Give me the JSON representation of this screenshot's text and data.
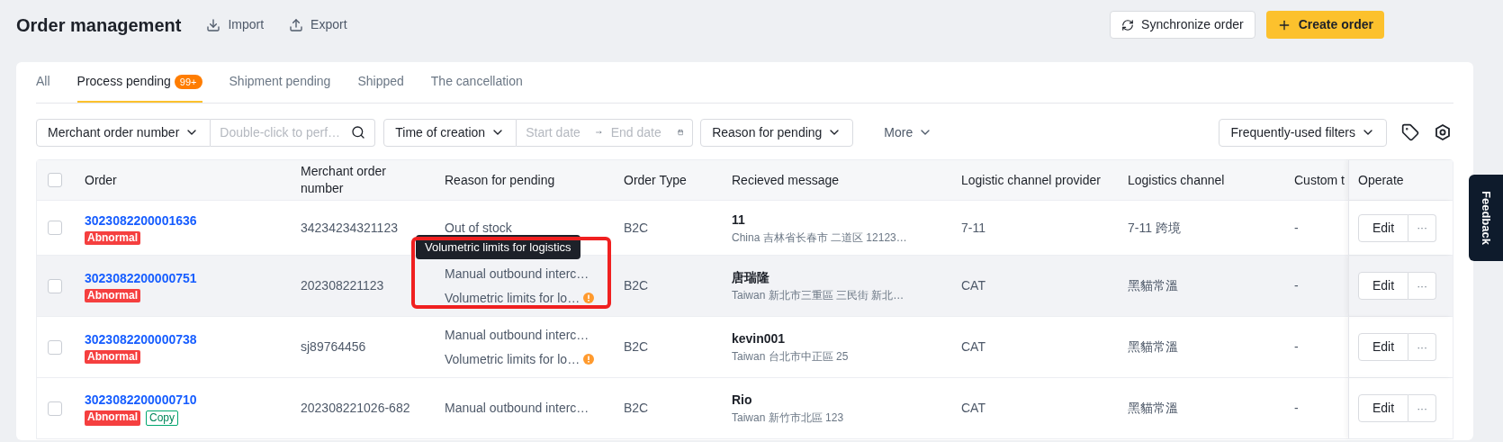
{
  "header": {
    "title": "Order management",
    "actions": [
      {
        "label": "Import",
        "kind": "import"
      },
      {
        "label": "Export",
        "kind": "export"
      }
    ],
    "buttons": [
      {
        "label": "Synchronize order",
        "kind": "secondary"
      },
      {
        "label": "Create order",
        "kind": "primary"
      }
    ]
  },
  "tabs": [
    {
      "label": "All",
      "selected": false
    },
    {
      "label": "Process pending",
      "badge": "99+",
      "selected": true
    },
    {
      "label": "Shipment pending",
      "selected": false
    },
    {
      "label": "Shipped",
      "selected": false
    },
    {
      "label": "The cancellation",
      "selected": false
    }
  ],
  "filters": {
    "search_type": "Merchant order number",
    "search_placeholder": "Double-click to perf…",
    "time_type": "Time of creation",
    "start_placeholder": "Start date",
    "end_placeholder": "End date",
    "reason": "Reason for pending",
    "more": "More",
    "frequent": "Frequently-used filters"
  },
  "table": {
    "all_checked": false,
    "columns": [
      "Order",
      "Merchant order number",
      "Reason for pending",
      "Order Type",
      "Recieved message",
      "Logistic channel provider",
      "Logistics channel",
      "Custom t",
      "Operate"
    ],
    "rows": [
      {
        "checked": false,
        "hovered": false,
        "order": "3023082200001636",
        "tags": [
          {
            "label": "Abnormal",
            "kind": "error"
          }
        ],
        "merchant": "34234234321123",
        "reasons": [
          {
            "text": "Out of stock",
            "warning": false,
            "highlighted": false
          }
        ],
        "type": "B2C",
        "name": "11",
        "country": "China",
        "address": "吉林省长春市 二道区 12123…",
        "provider": "7-11",
        "channel": "7-11 跨境",
        "custom": "-",
        "edit": "Edit",
        "more": "···"
      },
      {
        "checked": false,
        "hovered": true,
        "order": "3023082200000751",
        "tags": [
          {
            "label": "Abnormal",
            "kind": "error"
          }
        ],
        "merchant": "202308221123",
        "reasons": [
          {
            "text": "Manual outbound interc…",
            "warning": false,
            "highlighted": false
          },
          {
            "text": "Volumetric limits for lo…",
            "warning": true,
            "tooltip": "Volumetric limits for logistics",
            "highlighted": true
          }
        ],
        "type": "B2C",
        "name": "唐瑞隆",
        "country": "Taiwan",
        "address": "新北市三重區 三民街 新北…",
        "provider": "CAT",
        "channel": "黑貓常溫",
        "custom": "-",
        "edit": "Edit",
        "more": "···"
      },
      {
        "checked": false,
        "hovered": false,
        "order": "3023082200000738",
        "tags": [
          {
            "label": "Abnormal",
            "kind": "error"
          }
        ],
        "merchant": "sj89764456",
        "reasons": [
          {
            "text": "Manual outbound interc…",
            "warning": false,
            "highlighted": false
          },
          {
            "text": "Volumetric limits for lo…",
            "warning": true,
            "highlighted": false
          }
        ],
        "type": "B2C",
        "name": "kevin001",
        "country": "Taiwan",
        "address": "台北市中正區 25",
        "provider": "CAT",
        "channel": "黑貓常溫",
        "custom": "-",
        "edit": "Edit",
        "more": "···"
      },
      {
        "checked": false,
        "hovered": false,
        "order": "3023082200000710",
        "tags": [
          {
            "label": "Abnormal",
            "kind": "error"
          },
          {
            "label": "Copy",
            "kind": "copy"
          }
        ],
        "merchant": "202308221026-682",
        "reasons": [
          {
            "text": "Manual outbound interc…",
            "warning": false,
            "highlighted": false
          }
        ],
        "type": "B2C",
        "name": "Rio",
        "country": "Taiwan",
        "address": "新竹市北區 123",
        "provider": "CAT",
        "channel": "黑貓常溫",
        "custom": "-",
        "edit": "Edit",
        "more": "···"
      }
    ]
  },
  "feedback": "Feedback"
}
